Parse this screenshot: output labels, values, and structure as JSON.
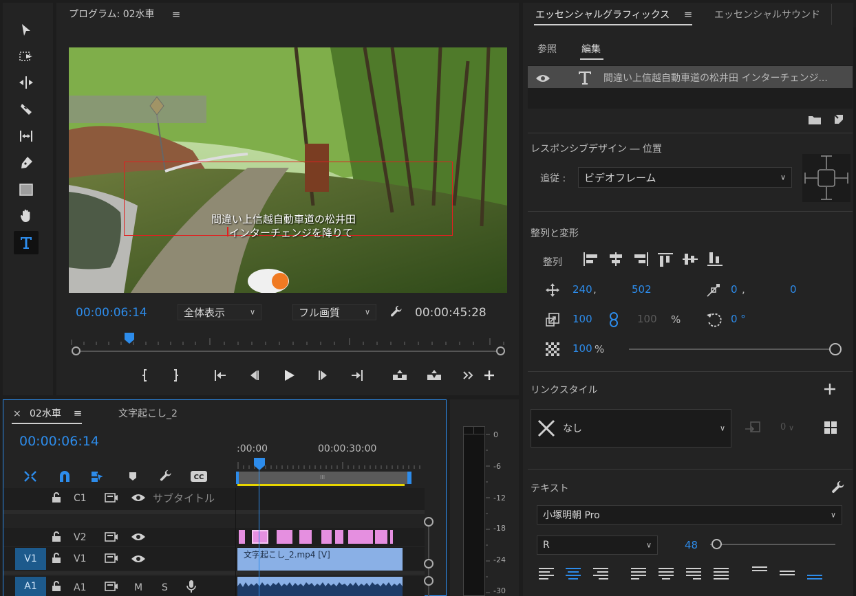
{
  "program_monitor": {
    "title": "プログラム: 02水車",
    "current_tc": "00:00:06:14",
    "duration_tc": "00:00:45:28",
    "zoom_select": "全体表示",
    "quality_select": "フル画質",
    "subtitle_line1": "間違い上信越自動車道の松井田",
    "subtitle_line2": "インターチェンジを降りて"
  },
  "essential_graphics": {
    "tab_graphics": "エッセンシャルグラフィックス",
    "tab_sound": "エッセンシャルサウンド",
    "subtab_browse": "参照",
    "subtab_edit": "編集",
    "layer_name": "間違い上信越自動車道の松井田 インターチェンジ...",
    "responsive_title": "レスポンシブデザイン ― 位置",
    "follow_label": "追従 :",
    "follow_value": "ビデオフレーム",
    "align_title": "整列と変形",
    "align_label": "整列",
    "pos_x": "240",
    "pos_comma": ",",
    "pos_y": "502",
    "anchor_x": "0",
    "anchor_comma": ",",
    "anchor_y": "0",
    "scale": "100",
    "scale_h": "100",
    "scale_unit": "%",
    "rotation": "0 °",
    "opacity": "100",
    "opacity_unit": "%",
    "opacity_slider": 1.0,
    "link_style_title": "リンクスタイル",
    "link_style_value": "なし",
    "link_style_count": "0",
    "text_title": "テキスト",
    "font_family": "小塚明朝 Pro",
    "font_style": "R",
    "font_size": "48",
    "font_size_slider": 0.05
  },
  "timeline": {
    "close": "×",
    "sequence_tab": "02水車",
    "other_tab": "文字起こし_2",
    "current_tc": "00:00:06:14",
    "ruler_start": ":00:00",
    "ruler_mid": "00:00:30:00",
    "tracks": {
      "c1": "C1",
      "c1_name": "サブタイトル",
      "v2": "V2",
      "v1_src": "V1",
      "v1": "V1",
      "a1_src": "A1",
      "a1": "A1",
      "m": "M",
      "s": "S"
    },
    "clip_name": "文字起こし_2.mp4 [V]",
    "playhead_fraction": 0.138
  },
  "meter": {
    "labels": [
      "0",
      "-6",
      "-12",
      "-18",
      "-24",
      "-30"
    ]
  },
  "icons": {
    "tools": [
      "selection-icon",
      "track-select-icon",
      "ripple-edit-icon",
      "razor-icon",
      "slip-icon",
      "pen-icon",
      "rectangle-icon",
      "hand-icon",
      "type-icon"
    ]
  }
}
